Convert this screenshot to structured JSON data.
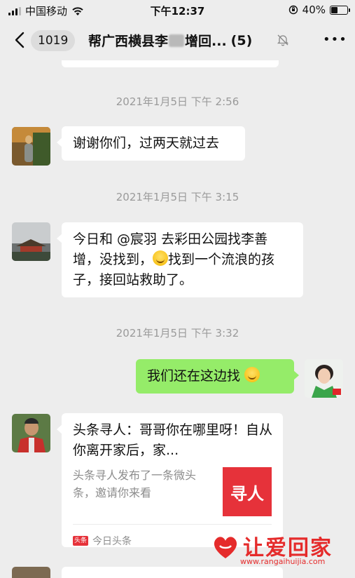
{
  "status_bar": {
    "carrier": "中国移动",
    "time": "下午12:37",
    "battery": "40%",
    "battery_level": 0.4
  },
  "nav": {
    "unread_count": "1019",
    "title_start": "帮广西横县李",
    "title_end": "增回...",
    "members": "(5)"
  },
  "messages": [
    {
      "timestamp": "2021年1月5日 下午 2:56",
      "text": "谢谢你们，过两天就过去"
    },
    {
      "timestamp": "2021年1月5日 下午 3:15",
      "text_before_emoji": "今日和 @宸羽 去彩田公园找李善增，没找到，",
      "text_after_emoji": "找到一个流浪的孩子，接回站救助了。"
    },
    {
      "timestamp": "2021年1月5日 下午 3:32",
      "text": "我们还在这边找"
    }
  ],
  "share_card": {
    "title": "头条寻人：哥哥你在哪里呀！自从你离开家后，家...",
    "description": "头条寻人发布了一条微头条，邀请你来看",
    "thumb_label": "寻人",
    "source_icon": "头条",
    "source": "今日头条"
  },
  "watermark": {
    "text": "让爱回家",
    "url": "www.rangaihuijia.com"
  },
  "colors": {
    "background": "#ededed",
    "my_bubble": "#95ec69",
    "accent_red": "#e6323a"
  }
}
